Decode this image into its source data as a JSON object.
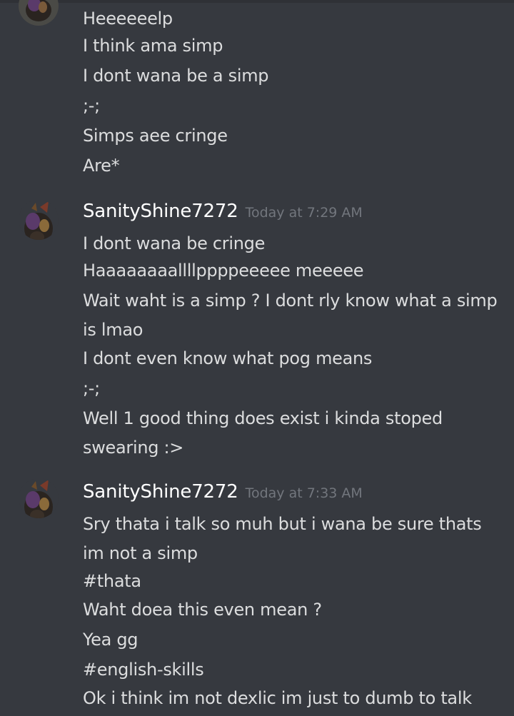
{
  "groups": [
    {
      "messages": [
        "Heeeeeelp",
        "I think ama simp",
        "I dont wana be a simp",
        ";-;",
        "Simps aee cringe",
        "Are*"
      ]
    },
    {
      "username": "SanityShine7272",
      "timestamp": "Today at 7:29 AM",
      "messages": [
        "I dont wana be cringe",
        "Haaaaaaaallllppppeeeee meeeee",
        "Wait waht is a simp ? I dont rly know what a simp is lmao",
        "I dont even know what pog means",
        ";-;",
        "Well 1 good thing does exist i kinda stoped swearing :>"
      ]
    },
    {
      "username": "SanityShine7272",
      "timestamp": "Today at 7:33 AM",
      "messages": [
        "Sry thata i talk so muh but i wana be sure thats im not a simp",
        "#thata",
        "Waht doea this even mean ?",
        "Yea gg",
        "#english-skills",
        "Ok i think im not dexlic im just to dumb to talk"
      ]
    }
  ],
  "colors": {
    "background": "#36393f",
    "username": "#ffffff",
    "timestamp": "#72767d",
    "message": "#dcddde"
  }
}
